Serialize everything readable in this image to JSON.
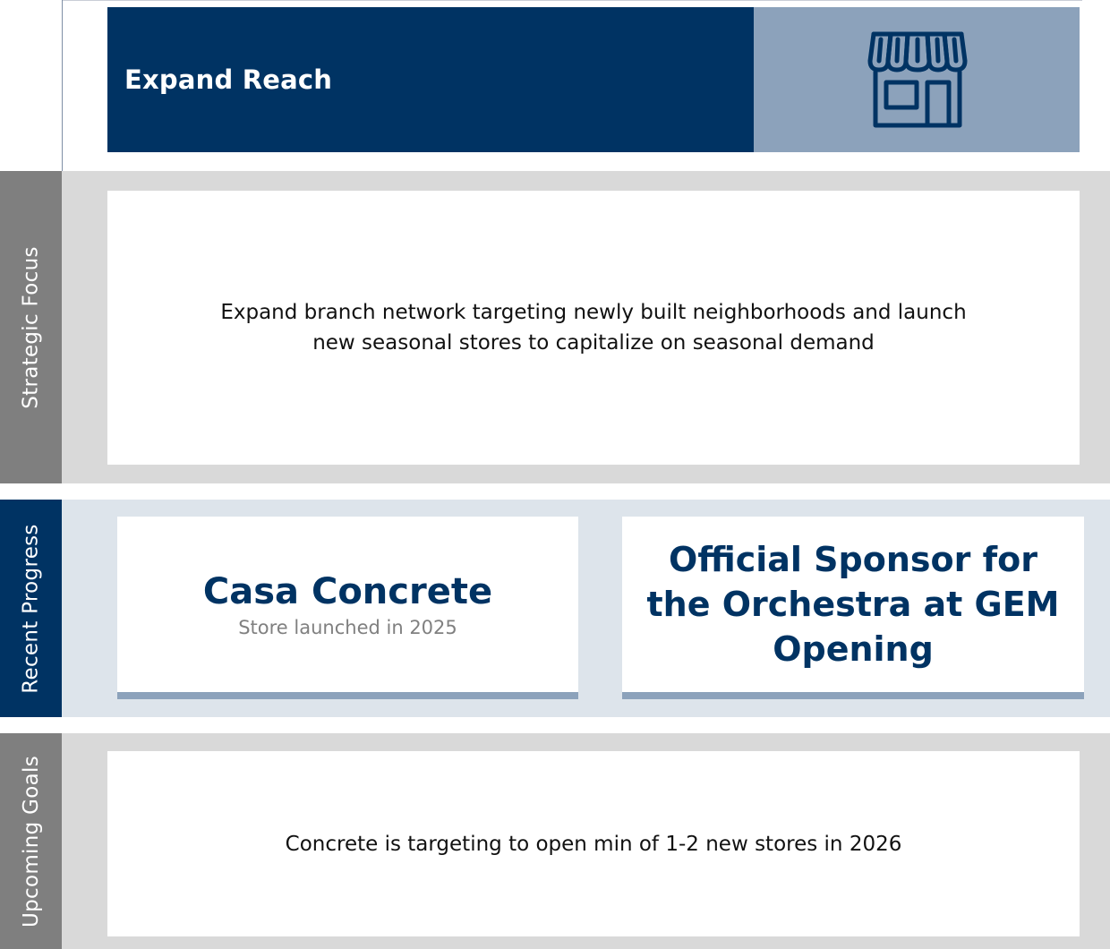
{
  "header": {
    "title": "Expand Reach",
    "icon": "storefront-icon",
    "title_bg": "#003363",
    "icon_bg": "#8ca2bb"
  },
  "strategic_focus": {
    "label": "Strategic Focus",
    "text": "Expand branch network targeting newly built neighborhoods and launch new seasonal stores to capitalize on seasonal demand"
  },
  "recent_progress": {
    "label": "Recent Progress",
    "cards": [
      {
        "title": "Casa Concrete",
        "subtitle": "Store launched in 2025"
      },
      {
        "title": "Official Sponsor for the Orchestra at GEM Opening"
      }
    ]
  },
  "upcoming_goals": {
    "label": "Upcoming Goals",
    "text": "Concrete is targeting to open min of 1-2 new stores in 2026"
  }
}
